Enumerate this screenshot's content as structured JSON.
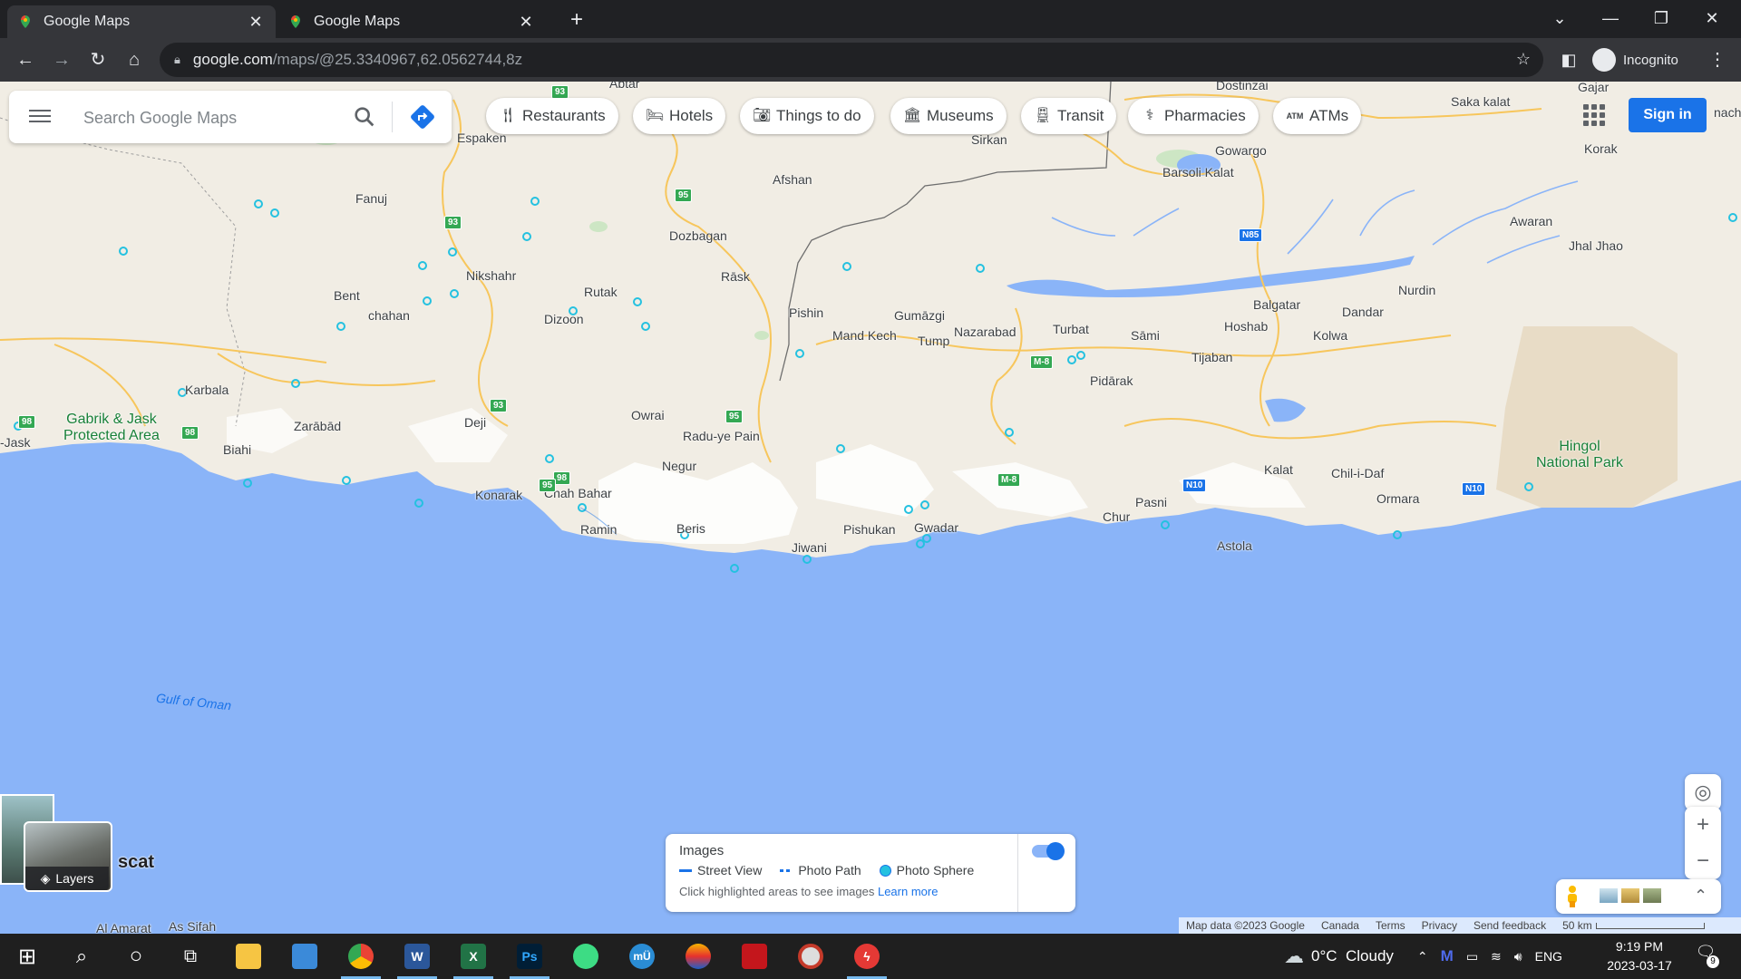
{
  "browser": {
    "tabs": [
      {
        "title": "Google Maps",
        "active": true
      },
      {
        "title": "Google Maps",
        "active": false
      }
    ],
    "new_tab": "+",
    "window_controls": {
      "tabsearch": "⌄",
      "minimize": "—",
      "restore": "❐",
      "close": "✕"
    },
    "url_host": "google.com",
    "url_path": "/maps/@25.3340967,62.0562744,8z",
    "profile_label": "Incognito"
  },
  "maps": {
    "search_placeholder": "Search Google Maps",
    "chips": [
      {
        "label": "Restaurants",
        "icon": "fork-knife-icon"
      },
      {
        "label": "Hotels",
        "icon": "bed-icon"
      },
      {
        "label": "Things to do",
        "icon": "camera-icon"
      },
      {
        "label": "Museums",
        "icon": "museum-icon"
      },
      {
        "label": "Transit",
        "icon": "train-icon"
      },
      {
        "label": "Pharmacies",
        "icon": "pharmacy-icon"
      },
      {
        "label": "ATMs",
        "icon": "atm-icon"
      }
    ],
    "atm_glyph": "ATM",
    "sign_in": "Sign in",
    "layers_label": "Layers",
    "images_panel": {
      "title": "Images",
      "street_view": "Street View",
      "photo_path": "Photo Path",
      "photo_sphere": "Photo Sphere",
      "hint": "Click highlighted areas to see images",
      "learn_more": "Learn more",
      "toggle_on": true
    },
    "places": [
      {
        "id": "jask",
        "name": "-Jask"
      },
      {
        "id": "gabrik",
        "name": "Gabrik & Jask\nProtected Area"
      },
      {
        "id": "karbala",
        "name": "Karbala"
      },
      {
        "id": "zarabad",
        "name": "Zarābād"
      },
      {
        "id": "biahi",
        "name": "Biahi"
      },
      {
        "id": "deji",
        "name": "Deji"
      },
      {
        "id": "konarak",
        "name": "Konarak"
      },
      {
        "id": "chahbahar",
        "name": "Chah Bahar"
      },
      {
        "id": "ramin",
        "name": "Ramin"
      },
      {
        "id": "beris",
        "name": "Beris"
      },
      {
        "id": "negur",
        "name": "Negur"
      },
      {
        "id": "owrai",
        "name": "Owrai"
      },
      {
        "id": "raduye",
        "name": "Radu-ye Pain"
      },
      {
        "id": "jiwani",
        "name": "Jiwani"
      },
      {
        "id": "pishukan",
        "name": "Pishukan"
      },
      {
        "id": "gwadar",
        "name": "Gwadar"
      },
      {
        "id": "pishin",
        "name": "Pishin"
      },
      {
        "id": "mandkech",
        "name": "Mand Kech"
      },
      {
        "id": "gumazgi",
        "name": "Gumāzgi"
      },
      {
        "id": "tump",
        "name": "Tump"
      },
      {
        "id": "nazarabad",
        "name": "Nazarabad"
      },
      {
        "id": "turbat",
        "name": "Turbat"
      },
      {
        "id": "sami",
        "name": "Sāmi"
      },
      {
        "id": "tijaban",
        "name": "Tijaban"
      },
      {
        "id": "hoshab",
        "name": "Hoshab"
      },
      {
        "id": "balgatar",
        "name": "Balgatar"
      },
      {
        "id": "dandar",
        "name": "Dandar"
      },
      {
        "id": "kolwa",
        "name": "Kolwa"
      },
      {
        "id": "nurdin",
        "name": "Nurdin"
      },
      {
        "id": "pidarak",
        "name": "Pidārak"
      },
      {
        "id": "kalat",
        "name": "Kalat"
      },
      {
        "id": "chilidaf",
        "name": "Chil-i-Daf"
      },
      {
        "id": "pasni",
        "name": "Pasni"
      },
      {
        "id": "chur",
        "name": "Chur"
      },
      {
        "id": "ormara",
        "name": "Ormara"
      },
      {
        "id": "astola",
        "name": "Astola"
      },
      {
        "id": "hingol",
        "name": "Hingol\nNational Park"
      },
      {
        "id": "espaken",
        "name": "Espaken"
      },
      {
        "id": "fanuj",
        "name": "Fanuj"
      },
      {
        "id": "nikshahr",
        "name": "Nikshahr"
      },
      {
        "id": "bent",
        "name": "Bent"
      },
      {
        "id": "chahan",
        "name": "chahan"
      },
      {
        "id": "rutak",
        "name": "Rutak"
      },
      {
        "id": "dizoon",
        "name": "Dizoon"
      },
      {
        "id": "dozbagan",
        "name": "Dozbagan"
      },
      {
        "id": "rask",
        "name": "Rāsk"
      },
      {
        "id": "afshan",
        "name": "Afshan"
      },
      {
        "id": "sirkan",
        "name": "Sirkan"
      },
      {
        "id": "dostinzai",
        "name": "Dostinzai"
      },
      {
        "id": "gowargo",
        "name": "Gowargo"
      },
      {
        "id": "barsoli",
        "name": "Barsoli Kalat"
      },
      {
        "id": "sakakalat",
        "name": "Saka kalat"
      },
      {
        "id": "gajar",
        "name": "Gajar"
      },
      {
        "id": "korak",
        "name": "Korak"
      },
      {
        "id": "awaran",
        "name": "Awaran"
      },
      {
        "id": "jhaljhao",
        "name": "Jhal Jhao"
      },
      {
        "id": "muscat",
        "name": "scat"
      },
      {
        "id": "alamarat",
        "name": "Al Amarat"
      },
      {
        "id": "assifah",
        "name": "As Sifah"
      },
      {
        "id": "abtar",
        "name": "Abtar"
      },
      {
        "id": "gulf",
        "name": "Gulf of Oman"
      },
      {
        "id": "nach",
        "name": "nach"
      }
    ],
    "shields": [
      {
        "id": "s98a",
        "text": "98",
        "color": "green"
      },
      {
        "id": "s98b",
        "text": "98",
        "color": "green"
      },
      {
        "id": "s93a",
        "text": "93",
        "color": "green"
      },
      {
        "id": "s93b",
        "text": "93",
        "color": "green"
      },
      {
        "id": "s93c",
        "text": "93",
        "color": "green"
      },
      {
        "id": "s95a",
        "text": "95",
        "color": "green"
      },
      {
        "id": "s95b",
        "text": "95",
        "color": "green"
      },
      {
        "id": "s98c",
        "text": "98",
        "color": "green"
      },
      {
        "id": "sm8",
        "text": "M-8",
        "color": "green"
      },
      {
        "id": "sm8b",
        "text": "M-8",
        "color": "green"
      },
      {
        "id": "sn10a",
        "text": "N10",
        "color": "blue"
      },
      {
        "id": "sn10b",
        "text": "N10",
        "color": "blue"
      },
      {
        "id": "sn85",
        "text": "N85",
        "color": "blue"
      },
      {
        "id": "s95c",
        "text": "95",
        "color": "green"
      }
    ],
    "attribution": {
      "map_data": "Map data ©2023 Google",
      "country": "Canada",
      "terms": "Terms",
      "privacy": "Privacy",
      "feedback": "Send feedback",
      "scale": "50 km"
    }
  },
  "taskbar": {
    "weather": "0°C  Cloudy",
    "lang": "ENG",
    "time": "9:19 PM",
    "date": "2023-03-17",
    "notifications": "9",
    "apps": [
      {
        "name": "windows-start",
        "glyph": "⊞",
        "active": false
      },
      {
        "name": "search",
        "glyph": "⌕",
        "active": false
      },
      {
        "name": "cortana",
        "glyph": "○",
        "active": false
      },
      {
        "name": "task-view",
        "glyph": "⧉",
        "active": false
      },
      {
        "name": "file-explorer",
        "glyph": "",
        "active": false
      },
      {
        "name": "control-panel",
        "glyph": "",
        "active": false
      },
      {
        "name": "chrome",
        "glyph": "",
        "active": true
      },
      {
        "name": "word",
        "glyph": "W",
        "active": true
      },
      {
        "name": "excel",
        "glyph": "X",
        "active": true
      },
      {
        "name": "photoshop",
        "glyph": "Ps",
        "active": true
      },
      {
        "name": "game",
        "glyph": "",
        "active": false
      },
      {
        "name": "mu",
        "glyph": "mÜ",
        "active": false
      },
      {
        "name": "app-rainbow",
        "glyph": "",
        "active": false
      },
      {
        "name": "app-red",
        "glyph": "",
        "active": false
      },
      {
        "name": "app-disc",
        "glyph": "",
        "active": false
      },
      {
        "name": "app-flash",
        "glyph": "ϟ",
        "active": true
      }
    ]
  },
  "colors": {
    "sea": "#8ab4f8",
    "land": "#f1ede4",
    "accent": "#1a73e8"
  }
}
